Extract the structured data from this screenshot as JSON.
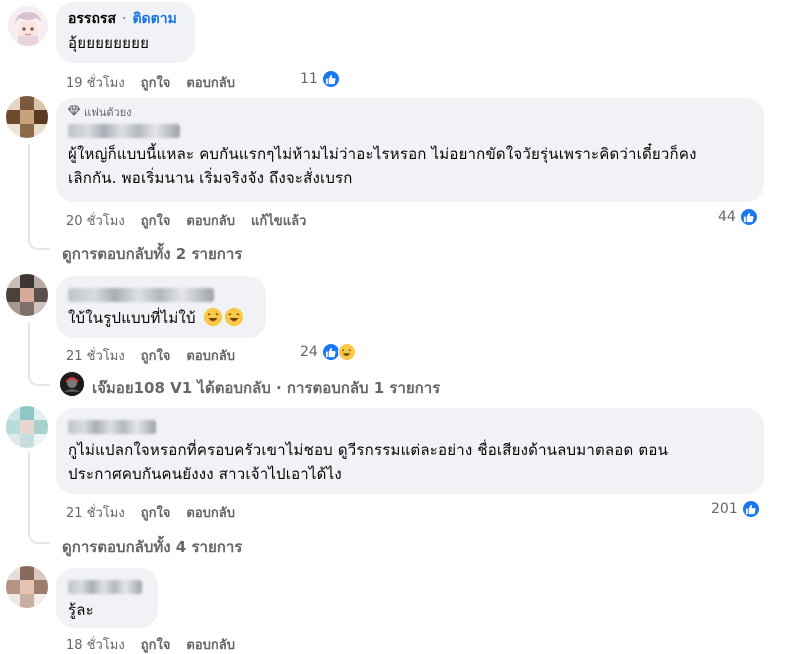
{
  "comments": [
    {
      "author": "อรรถรส",
      "follow_label": "ติดตาม",
      "separator": "·",
      "text": "อุ้ยยยยยยยย",
      "time": "19 ชั่วโมง",
      "like_label": "ถูกใจ",
      "reply_label": "ตอบกลับ",
      "reaction_count": "11"
    },
    {
      "badge": "แฟนตัวยง",
      "text_line1": "ผู้ใหญ่ก็แบบนี้แหละ คบกันแรกๆไม่ห้ามไม่ว่าอะไรหรอก ไม่อยากขัดใจวัยรุ่นเพราะคิดว่าเดี๋ยวก็คง",
      "text_line2": "เลิกกัน. พอเริ่มนาน เริ่มจริงจัง ถึงจะสั่งเบรก",
      "time": "20 ชั่วโมง",
      "like_label": "ถูกใจ",
      "reply_label": "ตอบกลับ",
      "edited_label": "แก้ไขแล้ว",
      "reaction_count": "44",
      "view_replies": "ดูการตอบกลับทั้ง 2 รายการ"
    },
    {
      "text": "ใบ้ในรูปแบบที่ไม่ใบ้",
      "time": "21 ชั่วโมง",
      "like_label": "ถูกใจ",
      "reply_label": "ตอบกลับ",
      "reaction_count": "24",
      "reply_summary": "เจ๊มอย108 V1 ได้ตอบกลับ · การตอบกลับ 1 รายการ"
    },
    {
      "text_line1": "กูไม่แปลกใจหรอกที่ครอบครัวเขาไม่ชอบ ดูวีรกรรมแต่ละอย่าง ชื่อเสียงด้านลบมาตลอด ตอน",
      "text_line2": "ประกาศคบกันคนยังงง สาวเจ้าไปเอาได้ไง",
      "time": "21 ชั่วโมง",
      "like_label": "ถูกใจ",
      "reply_label": "ตอบกลับ",
      "reaction_count": "201",
      "view_replies": "ดูการตอบกลับทั้ง 4 รายการ"
    },
    {
      "text": "รู้ละ",
      "time": "18 ชั่วโมง",
      "like_label": "ถูกใจ",
      "reply_label": "ตอบกลับ"
    }
  ],
  "colors": {
    "bubble_bg": "#f0f2f5",
    "meta_text": "#65676b",
    "link_blue": "#1b74e4",
    "like_blue": "#1877f2",
    "haha_yellow": "#f7c948"
  },
  "icons": [
    "like-icon",
    "haha-icon",
    "diamond-badge-icon",
    "laughing-emoji-icon"
  ]
}
